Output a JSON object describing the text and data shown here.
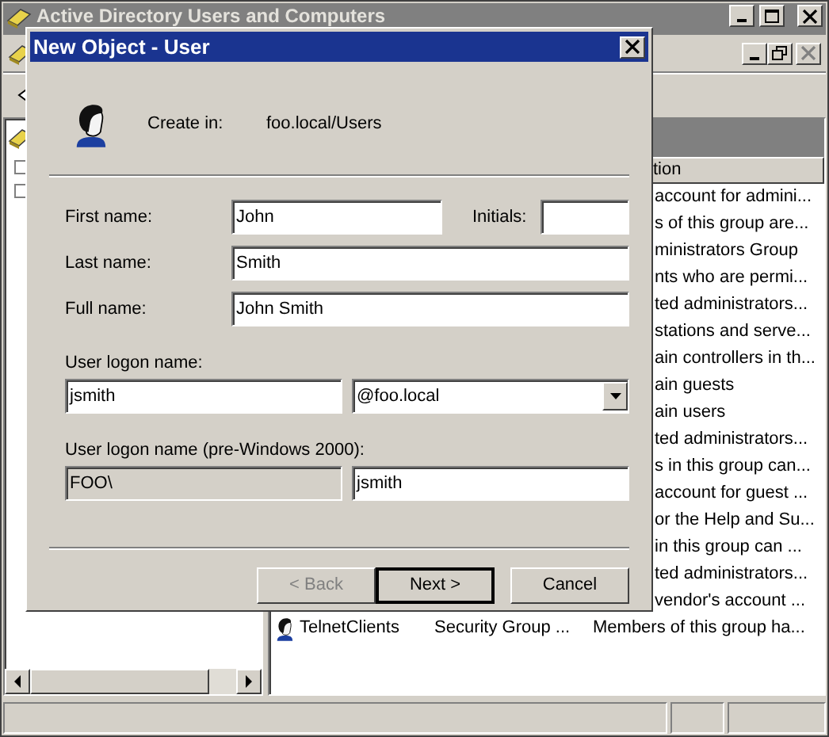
{
  "app_window": {
    "title": "Active Directory Users and Computers"
  },
  "list": {
    "column_header": "tion",
    "rows": [
      {
        "description": "account for admini..."
      },
      {
        "description": "s of this group are..."
      },
      {
        "description": "ministrators Group"
      },
      {
        "description": "nts who are permi..."
      },
      {
        "description": "ted administrators..."
      },
      {
        "description": "stations and serve..."
      },
      {
        "description": "ain controllers in th..."
      },
      {
        "description": "ain guests"
      },
      {
        "description": "ain users"
      },
      {
        "description": "ted administrators..."
      },
      {
        "description": "s in this group can..."
      },
      {
        "description": "account for guest ..."
      },
      {
        "description": "or the Help and Su..."
      },
      {
        "description": "in this group can ..."
      },
      {
        "description": "ted administrators..."
      },
      {
        "description": "vendor's account ..."
      },
      {
        "name": "TelnetClients",
        "type": "Security Group ...",
        "description": "Members of this group ha..."
      }
    ]
  },
  "dialog": {
    "title": "New Object - User",
    "create_in_label": "Create in:",
    "create_in_value": "foo.local/Users",
    "first_name": {
      "label": "First name:",
      "value": "John"
    },
    "initials": {
      "label": "Initials:"
    },
    "last_name": {
      "label": "Last name:",
      "value": "Smith"
    },
    "full_name": {
      "label": "Full name:",
      "value": "John Smith"
    },
    "logon_name": {
      "label": "User logon name:",
      "value": "jsmith",
      "domain": "@foo.local"
    },
    "pre_2000": {
      "label": "User logon name (pre-Windows 2000):",
      "domain": "FOO\\",
      "domain_disabled": true,
      "value": "jsmith"
    },
    "buttons": [
      {
        "label": "< Back",
        "disabled": true,
        "default": false
      },
      {
        "label": "Next >",
        "disabled": false,
        "default": true
      },
      {
        "label": "Cancel",
        "disabled": false,
        "default": false
      }
    ]
  }
}
